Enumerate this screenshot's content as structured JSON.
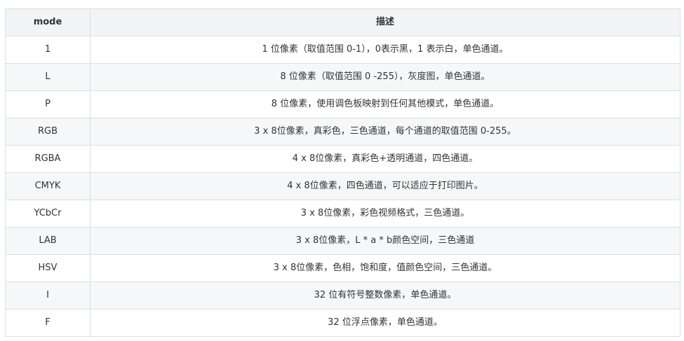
{
  "table": {
    "headers": [
      "mode",
      "描述"
    ],
    "rows": [
      {
        "mode": "1",
        "desc": "1 位像素（取值范围 0-1），0表示黑，1 表示白，单色通道。"
      },
      {
        "mode": "L",
        "desc": "8 位像素（取值范围 0 -255），灰度图，单色通道。"
      },
      {
        "mode": "P",
        "desc": "8 位像素，使用调色板映射到任何其他模式，单色通道。"
      },
      {
        "mode": "RGB",
        "desc": "3 x 8位像素，真彩色，三色通道，每个通道的取值范围 0-255。"
      },
      {
        "mode": "RGBA",
        "desc": "4 x 8位像素，真彩色+透明通道，四色通道。"
      },
      {
        "mode": "CMYK",
        "desc": "4 x 8位像素，四色通道，可以适应于打印图片。"
      },
      {
        "mode": "YCbCr",
        "desc": "3 x 8位像素，彩色视频格式，三色通道。"
      },
      {
        "mode": "LAB",
        "desc": "3 x 8位像素，L * a * b颜色空间，三色通道"
      },
      {
        "mode": "HSV",
        "desc": "3 x 8位像素，色相，饱和度，值颜色空间，三色通道。"
      },
      {
        "mode": "I",
        "desc": "32 位有符号整数像素，单色通道。"
      },
      {
        "mode": "F",
        "desc": "32 位浮点像素，单色通道。"
      }
    ]
  }
}
